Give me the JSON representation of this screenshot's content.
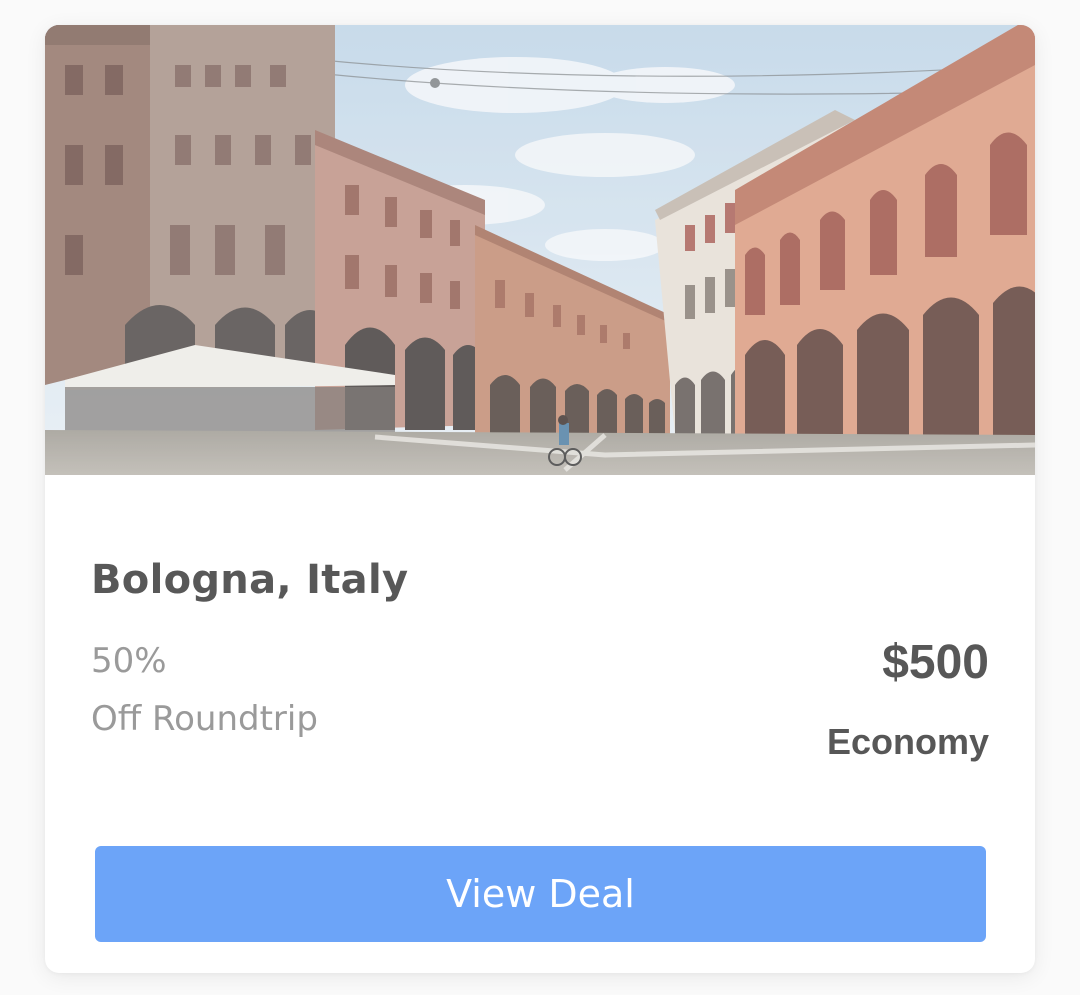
{
  "deal": {
    "destination": "Bologna, Italy",
    "discount": "50%",
    "discount_label": "Off Roundtrip",
    "price": "$500",
    "fare_class": "Economy",
    "cta_label": "View Deal"
  },
  "colors": {
    "button": "#6ca4f8",
    "title": "#585858",
    "muted": "#9a9a9a"
  },
  "image": {
    "subject": "piazza-with-arcaded-buildings-photo"
  }
}
